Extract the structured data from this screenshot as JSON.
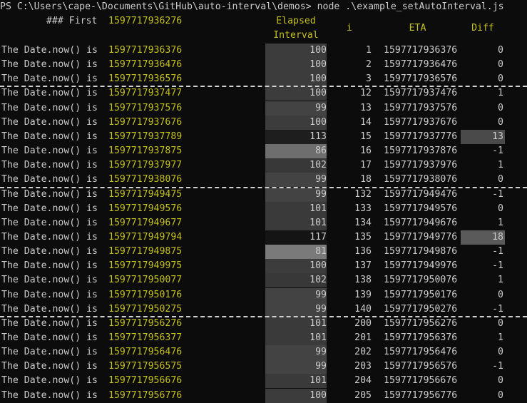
{
  "prompt": "PS C:\\Users\\cape-\\Documents\\GitHub\\auto-interval\\demos> node .\\example_setAutoInterval.js",
  "first_label": "### First",
  "first_value": "1597717936276",
  "headers": {
    "elapsed_line1": "Elapsed",
    "elapsed_line2": "Interval",
    "i": "i",
    "eta": "ETA",
    "diff": "Diff"
  },
  "row_label": "The Date.now() is",
  "rows": [
    {
      "date": "1597717936376",
      "elapsed": "100",
      "i": "1",
      "eta": "1597717936376",
      "diff": "0",
      "elapsed_bg": "#3c3c3c",
      "diff_bg": ""
    },
    {
      "date": "1597717936476",
      "elapsed": "100",
      "i": "2",
      "eta": "1597717936476",
      "diff": "0",
      "elapsed_bg": "#3c3c3c",
      "diff_bg": ""
    },
    {
      "date": "1597717936576",
      "elapsed": "100",
      "i": "3",
      "eta": "1597717936576",
      "diff": "0",
      "elapsed_bg": "#3c3c3c",
      "diff_bg": ""
    },
    {
      "date": "1597717937477",
      "elapsed": "100",
      "i": "12",
      "eta": "1597717937476",
      "diff": "1",
      "elapsed_bg": "#3c3c3c",
      "diff_bg": ""
    },
    {
      "date": "1597717937576",
      "elapsed": "99",
      "i": "13",
      "eta": "1597717937576",
      "diff": "0",
      "elapsed_bg": "#434343",
      "diff_bg": ""
    },
    {
      "date": "1597717937676",
      "elapsed": "100",
      "i": "14",
      "eta": "1597717937676",
      "diff": "0",
      "elapsed_bg": "#3c3c3c",
      "diff_bg": ""
    },
    {
      "date": "1597717937789",
      "elapsed": "113",
      "i": "15",
      "eta": "1597717937776",
      "diff": "13",
      "elapsed_bg": "#1e1e1e",
      "diff_bg": "#4a4a4a"
    },
    {
      "date": "1597717937875",
      "elapsed": "86",
      "i": "16",
      "eta": "1597717937876",
      "diff": "-1",
      "elapsed_bg": "#6e6e6e",
      "diff_bg": ""
    },
    {
      "date": "1597717937977",
      "elapsed": "102",
      "i": "17",
      "eta": "1597717937976",
      "diff": "1",
      "elapsed_bg": "#383838",
      "diff_bg": ""
    },
    {
      "date": "1597717938076",
      "elapsed": "99",
      "i": "18",
      "eta": "1597717938076",
      "diff": "0",
      "elapsed_bg": "#434343",
      "diff_bg": ""
    },
    {
      "date": "1597717949475",
      "elapsed": "99",
      "i": "132",
      "eta": "1597717949476",
      "diff": "-1",
      "elapsed_bg": "#434343",
      "diff_bg": ""
    },
    {
      "date": "1597717949576",
      "elapsed": "101",
      "i": "133",
      "eta": "1597717949576",
      "diff": "0",
      "elapsed_bg": "#3a3a3a",
      "diff_bg": ""
    },
    {
      "date": "1597717949677",
      "elapsed": "101",
      "i": "134",
      "eta": "1597717949676",
      "diff": "1",
      "elapsed_bg": "#3a3a3a",
      "diff_bg": ""
    },
    {
      "date": "1597717949794",
      "elapsed": "117",
      "i": "135",
      "eta": "1597717949776",
      "diff": "18",
      "elapsed_bg": "#141414",
      "diff_bg": "#5a5a5a"
    },
    {
      "date": "1597717949875",
      "elapsed": "81",
      "i": "136",
      "eta": "1597717949876",
      "diff": "-1",
      "elapsed_bg": "#7a7a7a",
      "diff_bg": ""
    },
    {
      "date": "1597717949975",
      "elapsed": "100",
      "i": "137",
      "eta": "1597717949976",
      "diff": "-1",
      "elapsed_bg": "#3c3c3c",
      "diff_bg": ""
    },
    {
      "date": "1597717950077",
      "elapsed": "102",
      "i": "138",
      "eta": "1597717950076",
      "diff": "1",
      "elapsed_bg": "#383838",
      "diff_bg": ""
    },
    {
      "date": "1597717950176",
      "elapsed": "99",
      "i": "139",
      "eta": "1597717950176",
      "diff": "0",
      "elapsed_bg": "#434343",
      "diff_bg": ""
    },
    {
      "date": "1597717950275",
      "elapsed": "99",
      "i": "140",
      "eta": "1597717950276",
      "diff": "-1",
      "elapsed_bg": "#434343",
      "diff_bg": ""
    },
    {
      "date": "1597717956276",
      "elapsed": "101",
      "i": "200",
      "eta": "1597717956276",
      "diff": "0",
      "elapsed_bg": "#3a3a3a",
      "diff_bg": ""
    },
    {
      "date": "1597717956377",
      "elapsed": "101",
      "i": "201",
      "eta": "1597717956376",
      "diff": "1",
      "elapsed_bg": "#3a3a3a",
      "diff_bg": ""
    },
    {
      "date": "1597717956476",
      "elapsed": "99",
      "i": "202",
      "eta": "1597717956476",
      "diff": "0",
      "elapsed_bg": "#434343",
      "diff_bg": ""
    },
    {
      "date": "1597717956575",
      "elapsed": "99",
      "i": "203",
      "eta": "1597717956576",
      "diff": "-1",
      "elapsed_bg": "#434343",
      "diff_bg": ""
    },
    {
      "date": "1597717956676",
      "elapsed": "101",
      "i": "204",
      "eta": "1597717956676",
      "diff": "0",
      "elapsed_bg": "#3a3a3a",
      "diff_bg": ""
    },
    {
      "date": "1597717956776",
      "elapsed": "100",
      "i": "205",
      "eta": "1597717956776",
      "diff": "0",
      "elapsed_bg": "#3c3c3c",
      "diff_bg": ""
    }
  ],
  "separators_after_row": [
    2,
    9,
    18
  ],
  "colors": {
    "background": "#0c0c0c",
    "text": "#cccccc",
    "yellow": "#c5c01e",
    "separator": "#d0d0d0"
  }
}
